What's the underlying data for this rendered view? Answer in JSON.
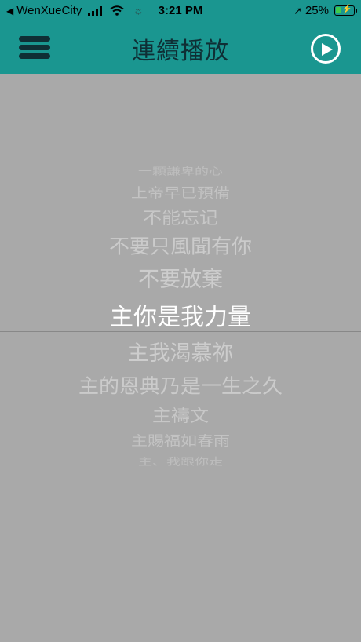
{
  "status_bar": {
    "back_label": "◀",
    "carrier": "WenXueCity",
    "time": "3:21 PM",
    "battery_percent": "25%",
    "battery_level": 0.25
  },
  "header": {
    "title": "連續播放",
    "menu_icon": "hamburger-menu-icon",
    "play_icon": "play-circle-icon"
  },
  "picker": {
    "items": [
      "一顆謙卑的心",
      "上帝早已預備",
      "不能忘记",
      "不要只風聞有你",
      "不要放棄",
      "主你是我力量",
      "主我渴慕祢",
      "主的恩典乃是一生之久",
      "主禱文",
      "主賜福如春雨",
      "主、我跟你走"
    ],
    "selected_index": 5
  },
  "colors": {
    "header_bg": "#1a9690",
    "page_bg": "#a9a9a9",
    "title_color": "#0f2f35",
    "selected_text": "#ffffff",
    "other_text": "#cfcfcf"
  }
}
